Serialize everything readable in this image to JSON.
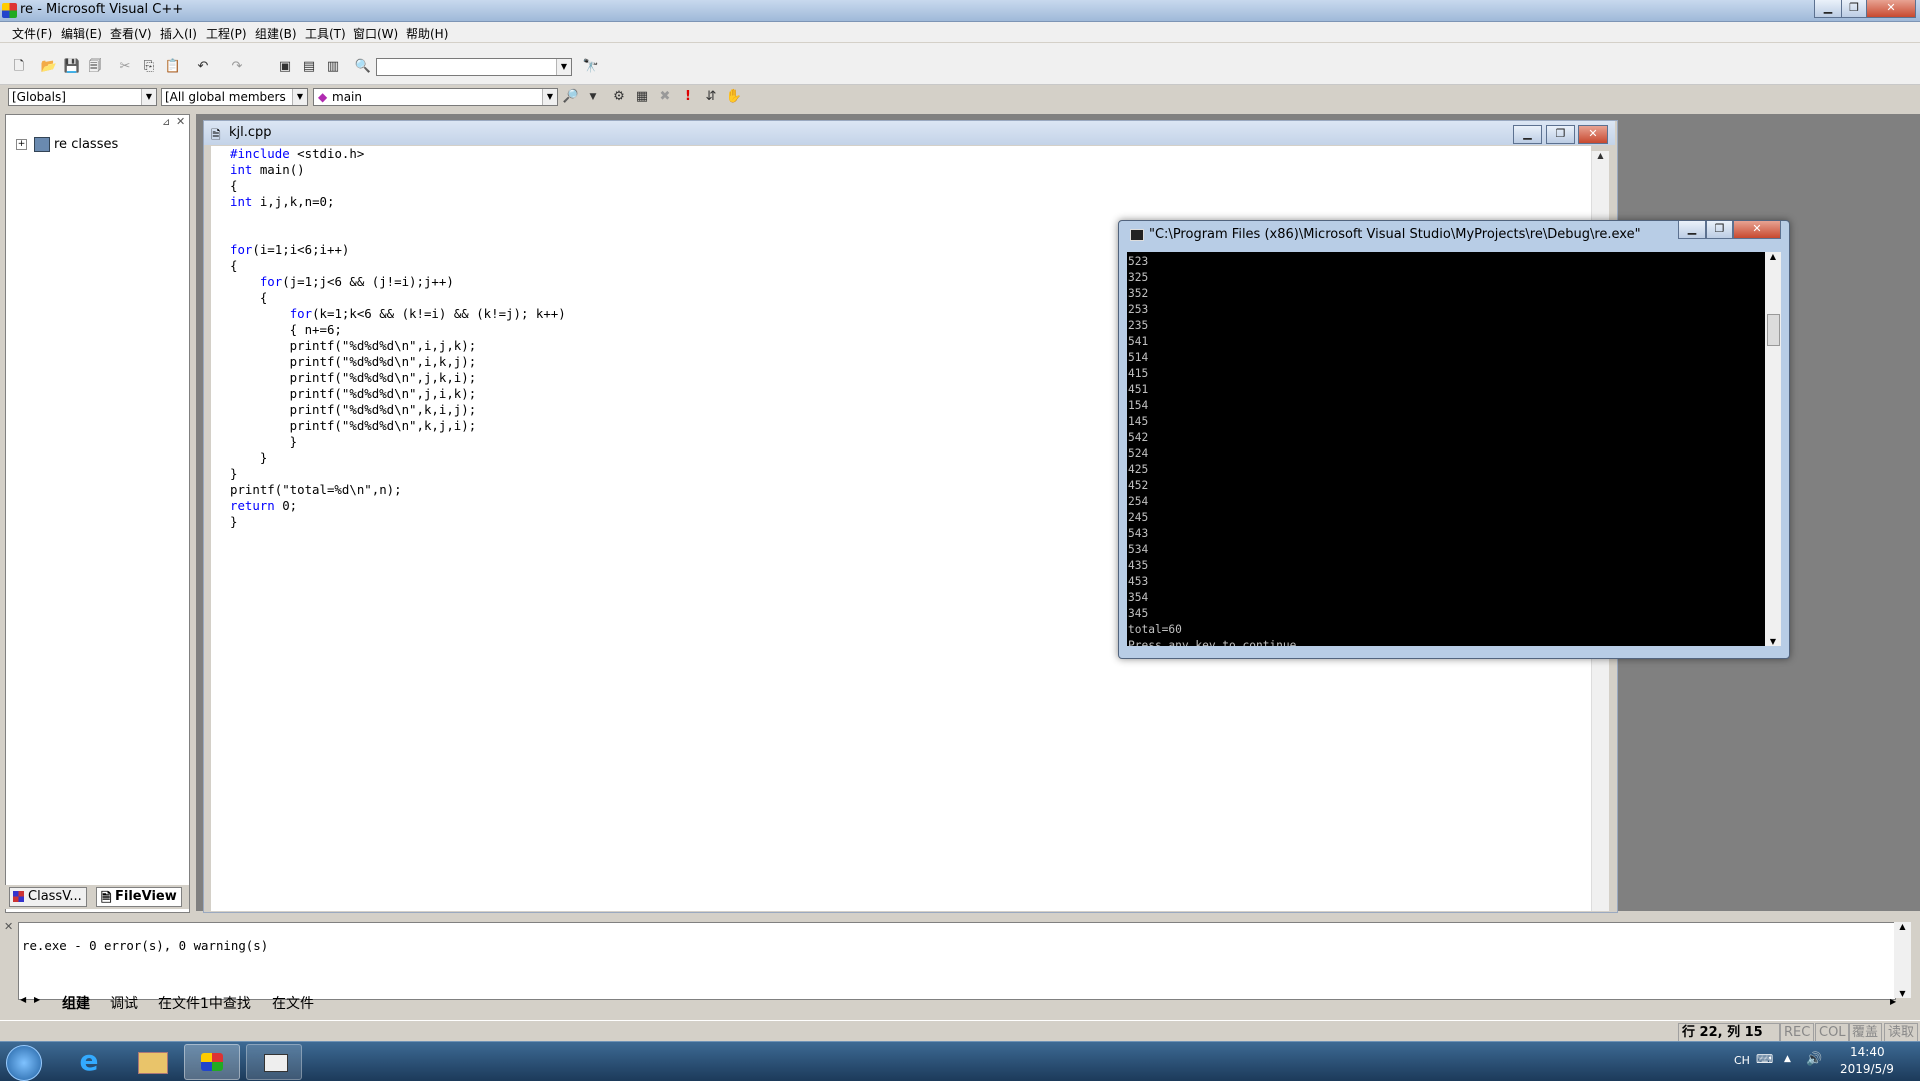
{
  "window": {
    "title": "re - Microsoft Visual C++",
    "caption_buttons": [
      "minimize",
      "restore",
      "close"
    ]
  },
  "menu": [
    "文件(F)",
    "编辑(E)",
    "查看(V)",
    "插入(I)",
    "工程(P)",
    "组建(B)",
    "工具(T)",
    "窗口(W)",
    "帮助(H)"
  ],
  "toolbar": {
    "find_combo_value": "",
    "globals_combo": "[Globals]",
    "members_combo": "[All global members",
    "function_combo": "main"
  },
  "workspace": {
    "tree_root": "re classes",
    "tabs": [
      "ClassV...",
      "FileView"
    ]
  },
  "editor": {
    "filename": "kjl.cpp",
    "code_lines": [
      "#include <stdio.h>",
      "int main()",
      "{",
      "int i,j,k,n=0;",
      "",
      "",
      "for(i=1;i<6;i++)",
      "{",
      "    for(j=1;j<6 && (j!=i);j++)",
      "    {",
      "        for(k=1;k<6 && (k!=i) && (k!=j); k++)",
      "        { n+=6;",
      "        printf(\"%d%d%d\\n\",i,j,k);",
      "        printf(\"%d%d%d\\n\",i,k,j);",
      "        printf(\"%d%d%d\\n\",j,k,i);",
      "        printf(\"%d%d%d\\n\",j,i,k);",
      "        printf(\"%d%d%d\\n\",k,i,j);",
      "        printf(\"%d%d%d\\n\",k,j,i);",
      "        }",
      "    }",
      "}",
      "printf(\"total=%d\\n\",n);",
      "return 0;",
      "}"
    ]
  },
  "console": {
    "title": "\"C:\\Program Files (x86)\\Microsoft Visual Studio\\MyProjects\\re\\Debug\\re.exe\"",
    "lines": [
      "523",
      "325",
      "352",
      "253",
      "235",
      "541",
      "514",
      "415",
      "451",
      "154",
      "145",
      "542",
      "524",
      "425",
      "452",
      "254",
      "245",
      "543",
      "534",
      "435",
      "453",
      "354",
      "345",
      "total=60",
      "Press any key to continue"
    ]
  },
  "output": {
    "message": "re.exe - 0 error(s), 0 warning(s)",
    "tabs": [
      "组建",
      "调试",
      "在文件1中查找",
      "在文件"
    ]
  },
  "statusbar": {
    "position": "行 22, 列 15",
    "indicators": [
      "REC",
      "COL",
      "覆盖",
      "读取"
    ]
  },
  "taskbar": {
    "lang": "CH",
    "time": "14:40",
    "date": "2019/5/9"
  },
  "colors": {
    "keyword": "#0000ff",
    "console_bg": "#000000",
    "console_text": "#c0c0c0"
  }
}
